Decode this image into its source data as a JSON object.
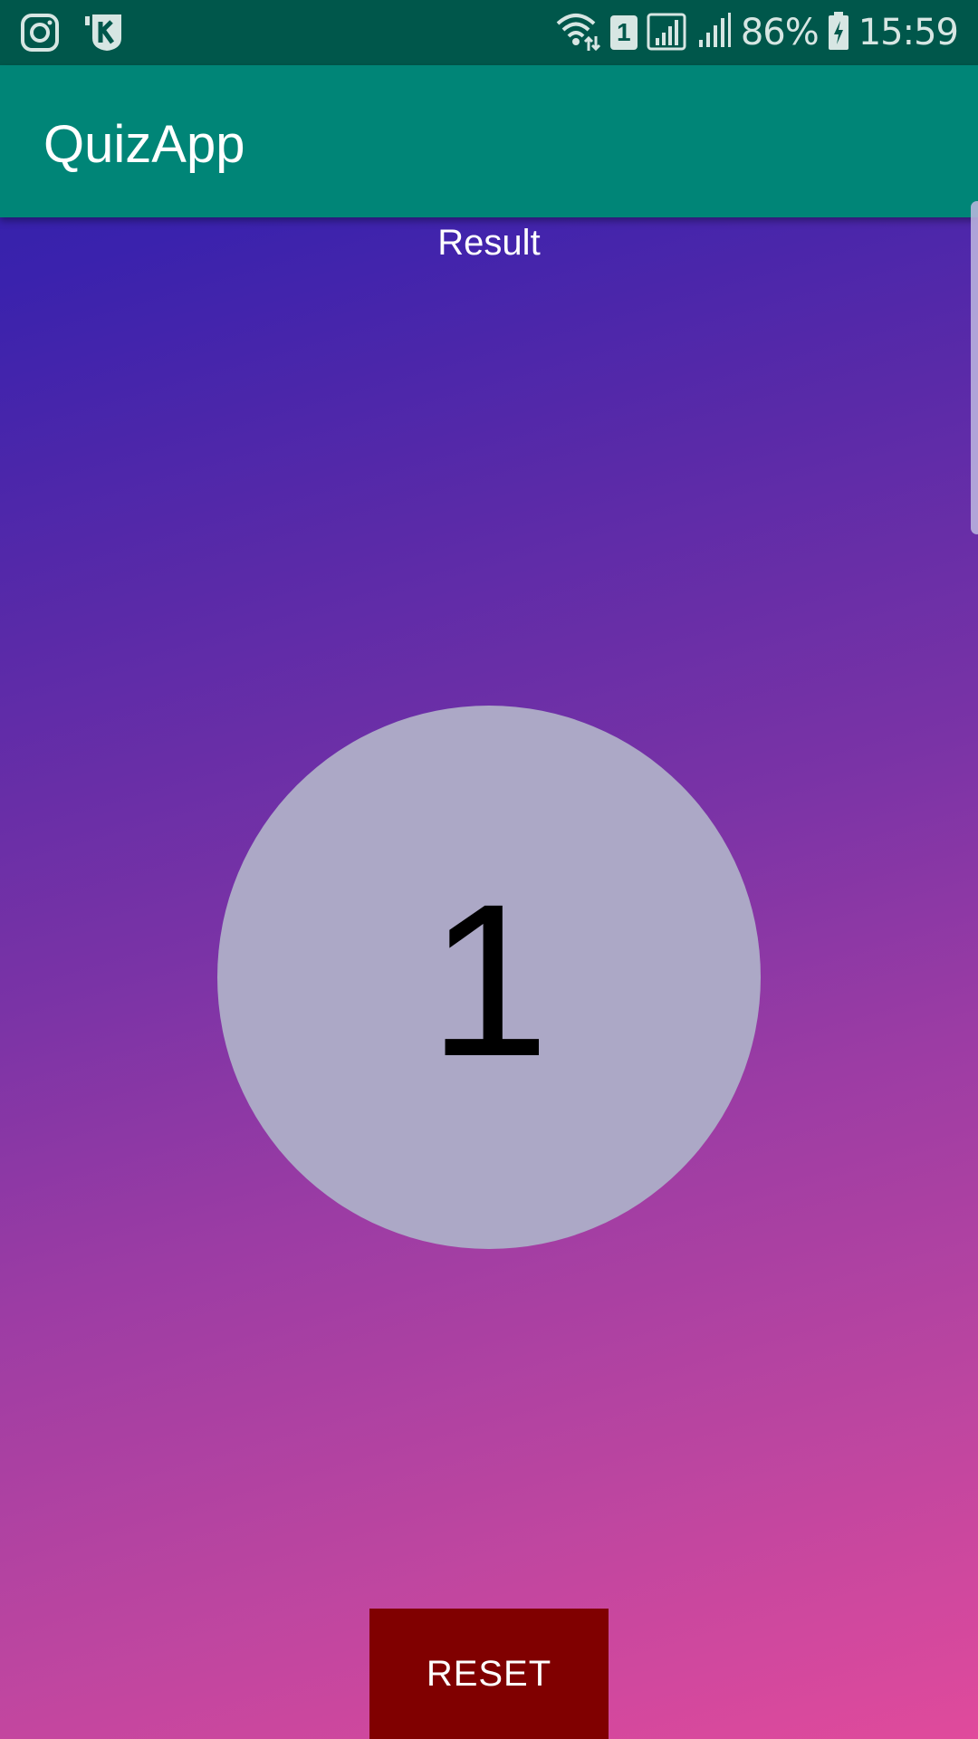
{
  "status_bar": {
    "left_icons": [
      "instagram-icon",
      "kik-icon"
    ],
    "right_icons": [
      "wifi-icon",
      "sim-1-icon",
      "signal-icon",
      "signal-icon",
      "battery-charging-icon"
    ],
    "sim_label": "1",
    "battery": "86%",
    "time": "15:59",
    "bg_color": "#00574b"
  },
  "app_bar": {
    "title": "QuizApp",
    "bg_color": "#008577"
  },
  "result": {
    "heading": "Result",
    "score": "1",
    "circle_color": "#aca8c6"
  },
  "reset_button": {
    "label": "RESET",
    "bg_color": "#800000"
  }
}
